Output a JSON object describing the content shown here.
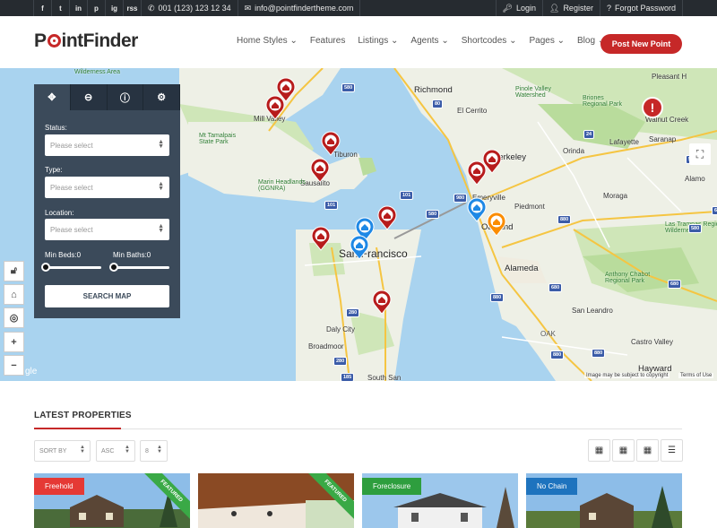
{
  "topbar": {
    "social": [
      "f",
      "t",
      "in",
      "p",
      "ig",
      "rss"
    ],
    "phone": "001 (123) 123 12 34",
    "email": "info@pointfindertheme.com",
    "login": "Login",
    "register": "Register",
    "forgot": "Forgot Password"
  },
  "header": {
    "logo": {
      "pre": "P",
      "post": "intFinder"
    },
    "nav": [
      "Home Styles",
      "Features",
      "Listings",
      "Agents",
      "Shortcodes",
      "Pages",
      "Blog"
    ],
    "post_button": "Post New Point"
  },
  "map": {
    "labels": {
      "richmond": "Richmond",
      "el_cerrito": "El Cerrito",
      "san_francisco": "San Francisco",
      "oakland": "Oakland",
      "alameda": "Alameda",
      "berkeley": "Berkeley",
      "emeryville": "Emeryville",
      "piedmont": "Piedmont",
      "orinda": "Orinda",
      "lafayette": "Lafayette",
      "moraga": "Moraga",
      "walnut_creek": "Walnut Creek",
      "alamo": "Alamo",
      "pleasant_hill": "Pleasant H",
      "saranap": "Saranap",
      "san_leandro": "San Leandro",
      "castro_valley": "Castro Valley",
      "hayward": "Hayward",
      "daly_city": "Daly City",
      "broadmoor": "Broadmoor",
      "south_san": "South San",
      "mill_valley": "Mill Valley",
      "tiburon": "Tiburon",
      "sausalito": "Sausalito",
      "wilderness_area": "Wilderness Area",
      "mt_tam": "Mt Tamalpais\nState Park",
      "marin_headlands": "Marin Headlands\n(GGNRA)",
      "pinole": "Pinole Valley\nWatershed",
      "briones": "Briones\nRegional Park",
      "anthony_chabot": "Anthony Chabot\nRegional Park",
      "las_trampas": "Las Trampas Regional\nWilderness",
      "oak": "OAK",
      "google": "gle",
      "terms": "Image may be subject to copyright",
      "terms2": "Terms of Use"
    },
    "highway_badges": [
      "580",
      "80",
      "101",
      "101",
      "580",
      "680",
      "24",
      "880",
      "880",
      "880",
      "580",
      "580",
      "980",
      "880",
      "1",
      "280",
      "280",
      "185",
      "680",
      "680"
    ]
  },
  "search": {
    "tabs": [
      "move-icon",
      "zoom-icon",
      "info-icon",
      "settings-icon"
    ],
    "status_label": "Status:",
    "status_placeholder": "Please select",
    "type_label": "Type:",
    "type_placeholder": "Please select",
    "location_label": "Location:",
    "location_placeholder": "Please select",
    "min_beds": "Min Beds:0",
    "min_baths": "Min Baths:0",
    "button": "SEARCH MAP"
  },
  "controls": [
    "lock-icon",
    "home-icon",
    "locate-icon",
    "+",
    "−"
  ],
  "properties": {
    "title": "LATEST PROPERTIES",
    "sort_by": "SORT BY",
    "order": "ASC",
    "count": "8",
    "cards": [
      {
        "tag": "Freehold",
        "tag_color": "#e53935",
        "featured": "FEATURED"
      },
      {
        "tag": "",
        "tag_color": "",
        "featured": "FEATURED"
      },
      {
        "tag": "Foreclosure",
        "tag_color": "#2e9e3e",
        "featured": ""
      },
      {
        "tag": "No Chain",
        "tag_color": "#1e73be",
        "featured": ""
      }
    ]
  },
  "colors": {
    "accent": "#c62828",
    "panel": "#3b4a5a",
    "water": "#a9d3ef",
    "land": "#f2efe9",
    "park": "#c8e5b0"
  }
}
